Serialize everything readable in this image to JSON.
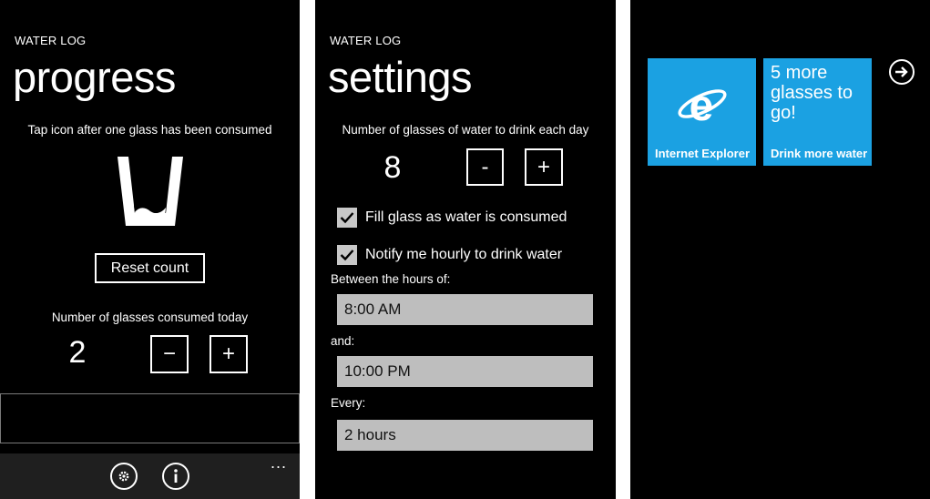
{
  "progress_screen": {
    "app_title": "WATER LOG",
    "page_title": "progress",
    "instruction": "Tap icon after one glass has been consumed",
    "reset_label": "Reset count",
    "consumed_label": "Number of glasses consumed today",
    "count": "2",
    "minus_label": "−",
    "plus_label": "+",
    "appbar_icons": [
      "settings-icon",
      "info-icon"
    ],
    "more_label": "..."
  },
  "settings_screen": {
    "app_title": "WATER LOG",
    "page_title": "settings",
    "goal_label": "Number of glasses of water to drink each day",
    "goal_count": "8",
    "minus_label": "-",
    "plus_label": "+",
    "fill_glass_label": "Fill glass as water is consumed",
    "fill_glass_checked": true,
    "notify_label": "Notify me hourly to drink water",
    "notify_checked": true,
    "between_label": "Between the hours of:",
    "start_time": "8:00 AM",
    "and_label": "and:",
    "end_time": "10:00 PM",
    "every_label": "Every:",
    "interval": "2 hours"
  },
  "start_screen": {
    "tiles": [
      {
        "label": "Internet Explorer",
        "icon": "internet-explorer-icon"
      },
      {
        "message": "5 more glasses to go!",
        "label": "Drink more water"
      }
    ],
    "arrow_icon": "arrow-right-icon"
  },
  "colors": {
    "accent": "#1ba1e2",
    "background": "#000000",
    "field": "#bebebe",
    "appbar": "#1f1f1f"
  }
}
